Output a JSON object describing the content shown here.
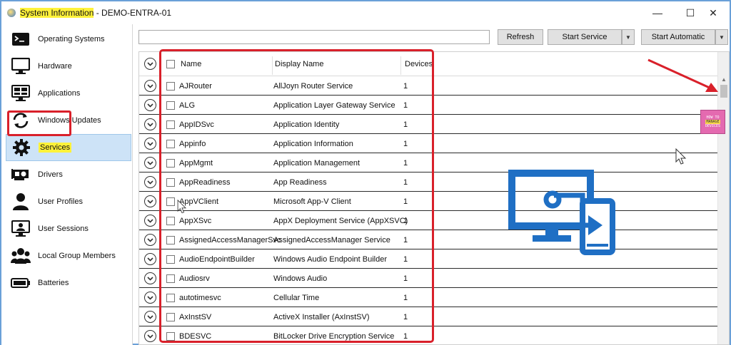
{
  "window": {
    "app_name": "System Information",
    "title_suffix": " - DEMO-ENTRA-01",
    "minimize": "—",
    "maximize": "☐",
    "close": "✕"
  },
  "sidebar": {
    "items": [
      {
        "label": "Operating Systems",
        "icon": "terminal-icon"
      },
      {
        "label": "Hardware",
        "icon": "monitor-icon"
      },
      {
        "label": "Applications",
        "icon": "applications-icon"
      },
      {
        "label": "Windows Updates",
        "icon": "refresh-icon"
      },
      {
        "label": "Services",
        "icon": "gear-icon"
      },
      {
        "label": "Drivers",
        "icon": "graphics-card-icon"
      },
      {
        "label": "User Profiles",
        "icon": "user-icon"
      },
      {
        "label": "User Sessions",
        "icon": "user-session-icon"
      },
      {
        "label": "Local Group Members",
        "icon": "group-icon"
      },
      {
        "label": "Batteries",
        "icon": "battery-icon"
      }
    ],
    "selected": "Services"
  },
  "toolbar": {
    "search_value": "",
    "refresh_label": "Refresh",
    "start_service_label": "Start Service",
    "start_automatic_label": "Start Automatic"
  },
  "grid": {
    "columns": [
      "Name",
      "Display Name",
      "Devices"
    ],
    "rows": [
      {
        "name": "AJRouter",
        "display": "AllJoyn Router Service",
        "devices": "1"
      },
      {
        "name": "ALG",
        "display": "Application Layer Gateway Service",
        "devices": "1"
      },
      {
        "name": "AppIDSvc",
        "display": "Application Identity",
        "devices": "1"
      },
      {
        "name": "Appinfo",
        "display": "Application Information",
        "devices": "1"
      },
      {
        "name": "AppMgmt",
        "display": "Application Management",
        "devices": "1"
      },
      {
        "name": "AppReadiness",
        "display": "App Readiness",
        "devices": "1"
      },
      {
        "name": "AppVClient",
        "display": "Microsoft App-V Client",
        "devices": "1"
      },
      {
        "name": "AppXSvc",
        "display": "AppX Deployment Service (AppXSVC)",
        "devices": "1"
      },
      {
        "name": "AssignedAccessManagerSvc",
        "display": "AssignedAccessManager Service",
        "devices": "1"
      },
      {
        "name": "AudioEndpointBuilder",
        "display": "Windows Audio Endpoint Builder",
        "devices": "1"
      },
      {
        "name": "Audiosrv",
        "display": "Windows Audio",
        "devices": "1"
      },
      {
        "name": "autotimesvc",
        "display": "Cellular Time",
        "devices": "1"
      },
      {
        "name": "AxInstSV",
        "display": "ActiveX Installer (AxInstSV)",
        "devices": "1"
      },
      {
        "name": "BDESVC",
        "display": "BitLocker Drive Encryption Service",
        "devices": "1"
      }
    ]
  },
  "watermark": {
    "line1": "HOW TO",
    "line2": "MANAGE",
    "line3": "DEVICES"
  },
  "colors": {
    "highlight": "#fff23a",
    "annotation_red": "#d9202a",
    "selection": "#cde3f7",
    "logo_blue": "#1f6fc4"
  }
}
